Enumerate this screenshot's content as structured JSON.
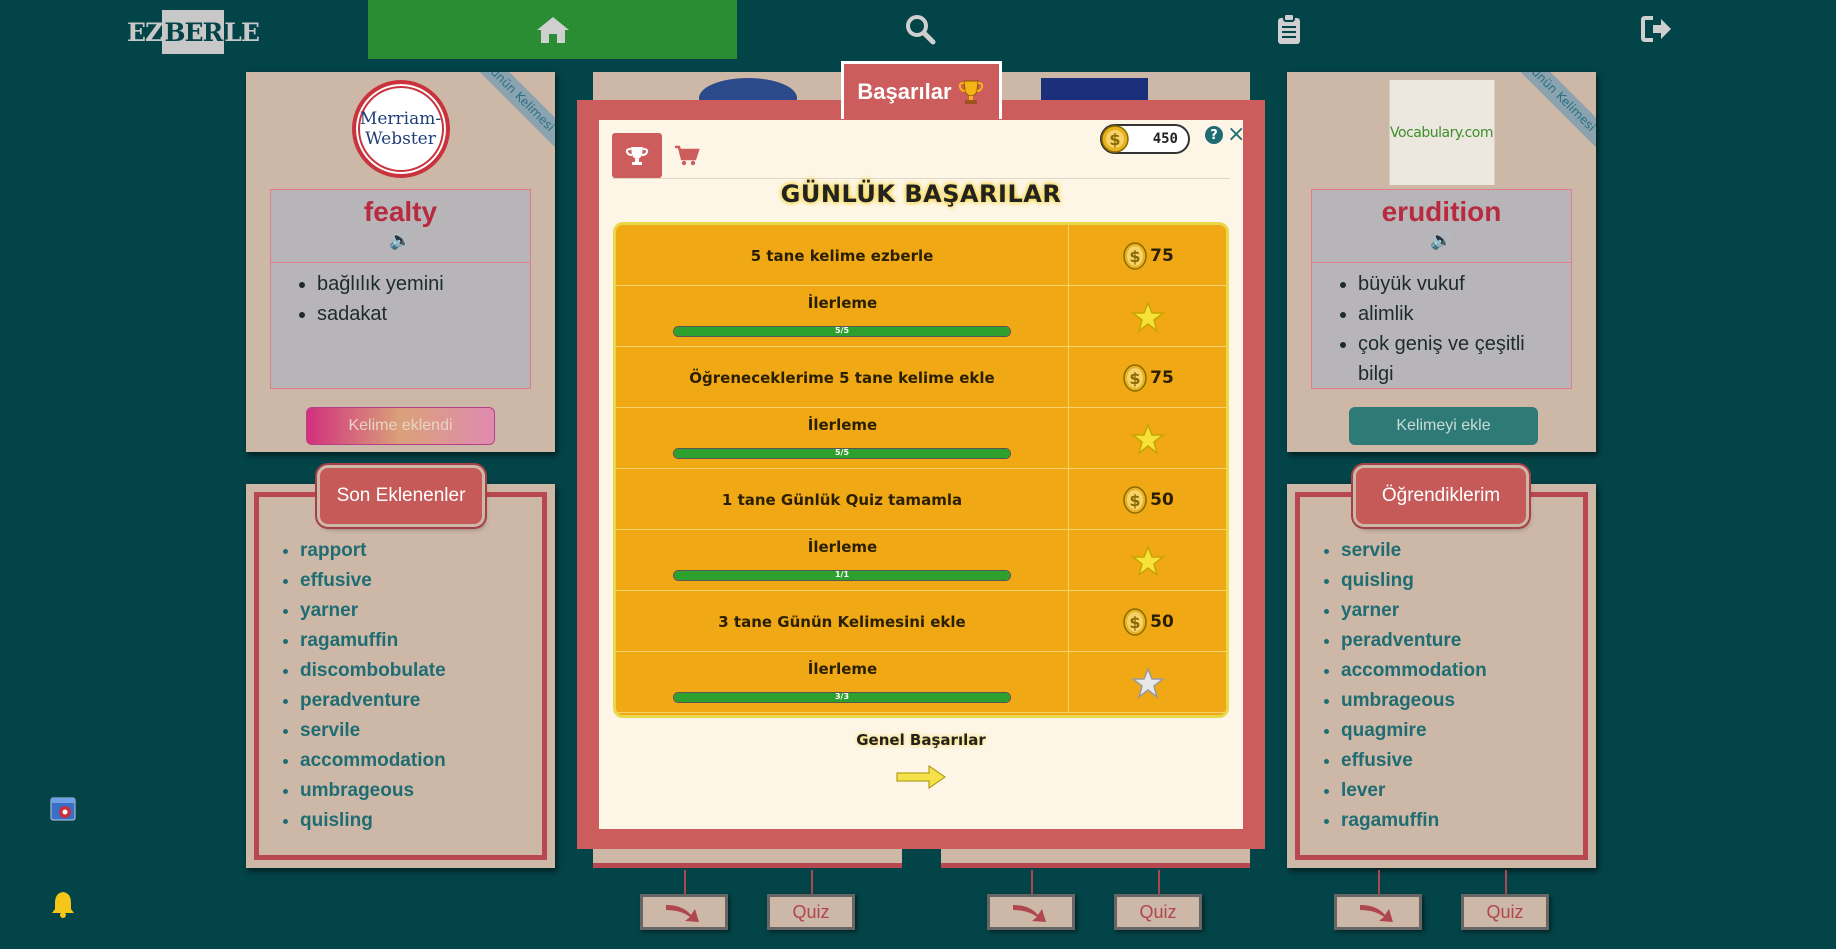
{
  "app": {
    "logo_text_a": "EZ",
    "logo_text_b": "BER",
    "logo_text_c": "LE"
  },
  "nav": {
    "home_icon": "home-icon",
    "search_icon": "search-icon",
    "clipboard_icon": "clipboard-icon",
    "logout_icon": "logout-icon",
    "active_color": "#2a8c33"
  },
  "wotd_left": {
    "ribbon": "Günün Kelimesi",
    "logo_line1": "Merriam-",
    "logo_line2": "Webster",
    "word": "fealty",
    "definitions": [
      "bağlılık yemini",
      "sadakat"
    ],
    "button": "Kelime eklendi"
  },
  "wotd_right": {
    "ribbon": "Günün Kelimesi",
    "logo": "Vocabulary.com",
    "word": "erudition",
    "definitions": [
      "büyük vukuf",
      "alimlik",
      "çok geniş ve çeşitli bilgi"
    ],
    "button": "Kelimeyi ekle"
  },
  "recent": {
    "title": "Son Eklenenler",
    "items": [
      "rapport",
      "effusive",
      "yarner",
      "ragamuffin",
      "discombobulate",
      "peradventure",
      "servile",
      "accommodation",
      "umbrageous",
      "quisling"
    ]
  },
  "learned": {
    "title": "Öğrendiklerim",
    "items": [
      "servile",
      "quisling",
      "yarner",
      "peradventure",
      "accommodation",
      "umbrageous",
      "quagmire",
      "effusive",
      "lever",
      "ragamuffin"
    ]
  },
  "bottom_buttons": {
    "quiz": "Quiz"
  },
  "modal": {
    "tab_title": "Başarılar",
    "coins": "450",
    "help": "?",
    "close": "×",
    "heading": "GÜNLÜK BAŞARILAR",
    "progress_label": "İlerleme",
    "achievements": [
      {
        "task": "5 tane kelime ezberle",
        "reward": "75",
        "progress": "5/5",
        "fraction": 1.0,
        "star": "gold"
      },
      {
        "task": "Öğreneceklerime 5 tane kelime ekle",
        "reward": "75",
        "progress": "5/5",
        "fraction": 1.0,
        "star": "gold"
      },
      {
        "task": "1 tane Günlük Quiz tamamla",
        "reward": "50",
        "progress": "1/1",
        "fraction": 1.0,
        "star": "gold"
      },
      {
        "task": "3 tane Günün Kelimesini ekle",
        "reward": "50",
        "progress": "3/3",
        "fraction": 1.0,
        "star": "silver"
      }
    ],
    "general": "Genel Başarılar"
  }
}
